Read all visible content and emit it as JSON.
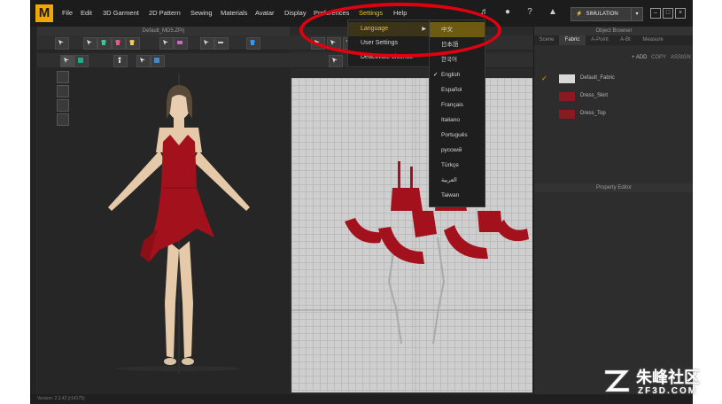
{
  "app": {
    "logo_letter": "M"
  },
  "menubar": {
    "items": [
      "File",
      "Edit",
      "3D Garment",
      "2D Pattern",
      "Sewing",
      "Materials",
      "Avatar",
      "Display",
      "Preferences",
      "Settings",
      "Help"
    ],
    "active_item": "Settings",
    "simulation_label": "SIMULATION"
  },
  "settings_menu": {
    "items": [
      "Language",
      "User Settings",
      "Deactivate License"
    ],
    "highlighted": "Language"
  },
  "language_menu": {
    "items": [
      "中文",
      "日本語",
      "한국어",
      "English",
      "Español",
      "Français",
      "Italiano",
      "Português",
      "русский",
      "Türkçe",
      "العربية",
      "Taiwan"
    ],
    "highlighted": "中文",
    "checked": "English"
  },
  "panel_3d": {
    "title": "Default_MD5.ZPrj"
  },
  "object_browser": {
    "title": "Object Browser",
    "tabs": [
      "Scene",
      "Fabric",
      "A-Point",
      "A-Bt",
      "Measure"
    ],
    "active_tab": "Fabric",
    "buttons": [
      "+ ADD",
      "COPY",
      "ASSIGN"
    ],
    "fabrics": [
      {
        "name": "Default_Fabric",
        "color": "#d8d8d8",
        "checked": true
      },
      {
        "name": "Dress_Skirt",
        "color": "#8a1a1f",
        "checked": false
      },
      {
        "name": "Dress_Top",
        "color": "#8a1a1f",
        "checked": false
      }
    ]
  },
  "property_editor": {
    "title": "Property Editor"
  },
  "status": {
    "text": "Version: 2.3.42   (r14175)"
  },
  "watermark": {
    "cn": "朱峰社区",
    "en": "ZF3D.COM"
  },
  "colors": {
    "accent": "#f5c000",
    "garment": "#a3121c",
    "highlight_ring": "#e00010"
  }
}
